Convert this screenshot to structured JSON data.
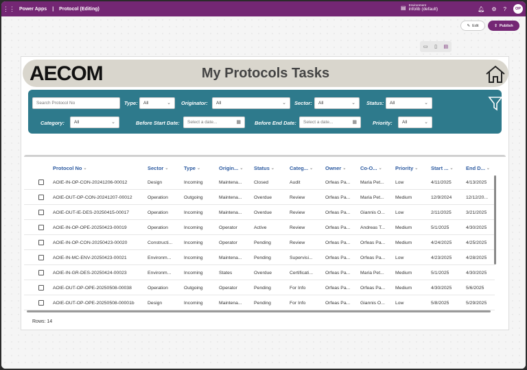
{
  "topbar": {
    "app_name": "Power Apps",
    "separator": "|",
    "doc_title": "Protocol (Editing)",
    "environment_label": "Environment",
    "environment_value": "infolib (default)",
    "avatar_initials": "OP"
  },
  "toolbar": {
    "edit_label": "Edit",
    "publish_label": "Publish"
  },
  "header": {
    "logo_text": "AECOM",
    "title": "My Protocols Tasks"
  },
  "filters": {
    "search_placeholder": "Search Protocol No",
    "type_label": "Type:",
    "type_value": "All",
    "originator_label": "Originator:",
    "originator_value": "All",
    "sector_label": "Sector:",
    "sector_value": "All",
    "status_label": "Status:",
    "status_value": "All",
    "category_label": "Category:",
    "category_value": "All",
    "before_start_label": "Before Start Date:",
    "before_start_placeholder": "Select a date...",
    "before_end_label": "Before End Date:",
    "before_end_placeholder": "Select a date...",
    "priority_label": "Priority:",
    "priority_value": "All"
  },
  "grid": {
    "columns": [
      "Protocol No",
      "Sector",
      "Type",
      "Origin...",
      "Status",
      "Categ...",
      "Owner",
      "Co-O...",
      "Priority",
      "Start ...",
      "End D..."
    ],
    "rows": [
      [
        "AOIE-IN-OP-CON-20241206-00012",
        "Design",
        "Incoming",
        "Maintena...",
        "Closed",
        "Audit",
        "Orfeas Pa...",
        "Maria Pet...",
        "Low",
        "4/11/2025",
        "4/13/2025"
      ],
      [
        "AOIE-OUT-OP-CON-20241207-00012",
        "Operation",
        "Outgoing",
        "Maintena...",
        "Overdue",
        "Review",
        "Orfeas Pa...",
        "Maria Pet...",
        "Medium",
        "12/9/2024",
        "12/12/20..."
      ],
      [
        "AOIE-OUT-IE-DES-20250415-00017",
        "Operation",
        "Incoming",
        "Maintena...",
        "Overdue",
        "Review",
        "Orfeas Pa...",
        "Giannis O...",
        "Low",
        "2/11/2025",
        "3/21/2025"
      ],
      [
        "AOIE-IN-OP-OPE-20250423-00019",
        "Operation",
        "Incoming",
        "Operator",
        "Active",
        "Review",
        "Orfeas Pa...",
        "Andreas T...",
        "Medium",
        "5/1/2025",
        "4/30/2025"
      ],
      [
        "AOIE-IN-OP-CON-20250423-00020",
        "Constructi...",
        "Incoming",
        "Operator",
        "Pending",
        "Review",
        "Orfeas Pa...",
        "Orfeas Pa...",
        "Medium",
        "4/24/2025",
        "4/25/2025"
      ],
      [
        "AOIE-IN-MC-ENV-20250423-00021",
        "Environm...",
        "Incoming",
        "Maintena...",
        "Pending",
        "Supervisi...",
        "Orfeas Pa...",
        "Orfeas Pa...",
        "Low",
        "4/23/2025",
        "4/28/2025"
      ],
      [
        "AOIE-IN-GR-DES-20250424-00023",
        "Environm...",
        "Incoming",
        "States",
        "Overdue",
        "Certificati...",
        "Orfeas Pa...",
        "Maria Pet...",
        "Medium",
        "5/1/2025",
        "4/30/2025"
      ],
      [
        "AOIE-OUT-OP-OPE-20250508-00038",
        "Operation",
        "Outgoing",
        "Operator",
        "Pending",
        "For Info",
        "Orfeas Pa...",
        "Orfeas Pa...",
        "Medium",
        "4/30/2025",
        "5/6/2025"
      ],
      [
        "AOIE-OUT-OP-OPE-20250508-00001b",
        "Design",
        "Incoming",
        "Maintena...",
        "Pending",
        "For Info",
        "Orfeas Pa...",
        "Giannis O...",
        "Low",
        "5/8/2025",
        "5/29/2025"
      ]
    ],
    "rows_count": "Rows: 14"
  },
  "colors": {
    "brand": "#742774",
    "filter_panel": "#2e7a8c",
    "header_band": "#d9d6cd",
    "column_header": "#2c5aa0"
  }
}
